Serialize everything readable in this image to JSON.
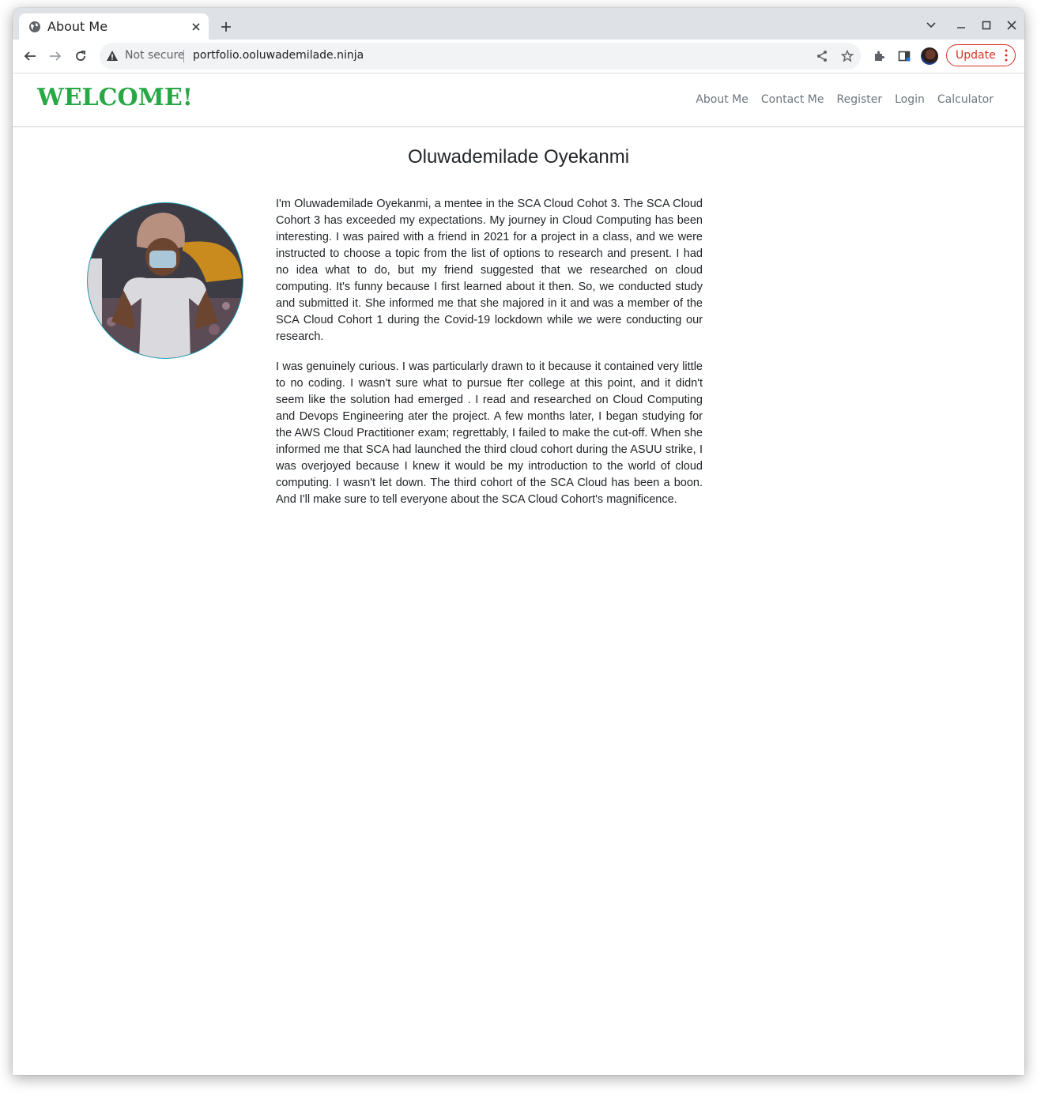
{
  "browser": {
    "tab_title": "About Me",
    "security_label": "Not secure",
    "url": "portfolio.ooluwademilade.ninja",
    "update_label": "Update"
  },
  "site": {
    "brand": "WELCOME!",
    "nav": [
      {
        "label": "About Me"
      },
      {
        "label": "Contact Me"
      },
      {
        "label": "Register"
      },
      {
        "label": "Login"
      },
      {
        "label": "Calculator"
      }
    ]
  },
  "about": {
    "name": "Oluwademilade Oyekanmi",
    "paragraphs": [
      "I'm Oluwademilade Oyekanmi, a mentee in the SCA Cloud Cohot 3. The SCA Cloud Cohort 3 has exceeded my expectations. My journey in Cloud Computing has been interesting. I was paired with a friend in 2021 for a project in a class, and we were instructed to choose a topic from the list of options to research and present. I had no idea what to do, but my friend suggested that we researched on cloud computing. It's funny because I first learned about it then. So, we conducted study and submitted it. She informed me that she majored in it and was a member of the SCA Cloud Cohort 1 during the Covid-19 lockdown while we were conducting our research.",
      "I was genuinely curious. I was particularly drawn to it because it contained very little to no coding. I wasn't sure what to pursue fter college at this point, and it didn't seem like the solution had emerged . I read and researched on Cloud Computing and Devops Engineering ater the project. A few months later, I began studying for the AWS Cloud Practitioner exam; regrettably, I failed to make the cut-off. When she informed me that SCA had launched the third cloud cohort during the ASUU strike, I was overjoyed because I knew it would be my introduction to the world of cloud computing. I wasn't let down. The third cohort of the SCA Cloud has been a boon. And I'll make sure to tell everyone about the SCA Cloud Cohort's magnificence."
    ]
  },
  "colors": {
    "brand": "#28a745",
    "nav_link": "#6c757d",
    "update": "#d93025",
    "profile_border": "#17a2b8"
  }
}
